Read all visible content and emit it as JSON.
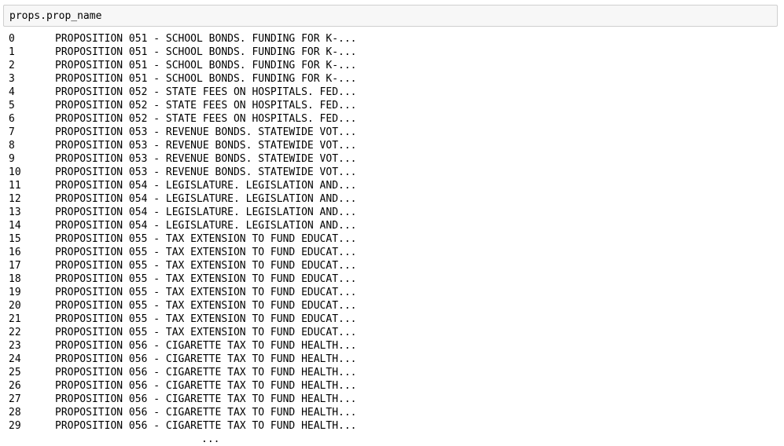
{
  "input": {
    "code": "props.prop_name"
  },
  "output": {
    "rows": [
      {
        "index": "0",
        "value": "PROPOSITION 051 - SCHOOL BONDS. FUNDING FOR K-..."
      },
      {
        "index": "1",
        "value": "PROPOSITION 051 - SCHOOL BONDS. FUNDING FOR K-..."
      },
      {
        "index": "2",
        "value": "PROPOSITION 051 - SCHOOL BONDS. FUNDING FOR K-..."
      },
      {
        "index": "3",
        "value": "PROPOSITION 051 - SCHOOL BONDS. FUNDING FOR K-..."
      },
      {
        "index": "4",
        "value": "PROPOSITION 052 - STATE FEES ON HOSPITALS. FED..."
      },
      {
        "index": "5",
        "value": "PROPOSITION 052 - STATE FEES ON HOSPITALS. FED..."
      },
      {
        "index": "6",
        "value": "PROPOSITION 052 - STATE FEES ON HOSPITALS. FED..."
      },
      {
        "index": "7",
        "value": "PROPOSITION 053 - REVENUE BONDS. STATEWIDE VOT..."
      },
      {
        "index": "8",
        "value": "PROPOSITION 053 - REVENUE BONDS. STATEWIDE VOT..."
      },
      {
        "index": "9",
        "value": "PROPOSITION 053 - REVENUE BONDS. STATEWIDE VOT..."
      },
      {
        "index": "10",
        "value": "PROPOSITION 053 - REVENUE BONDS. STATEWIDE VOT..."
      },
      {
        "index": "11",
        "value": "PROPOSITION 054 - LEGISLATURE. LEGISLATION AND..."
      },
      {
        "index": "12",
        "value": "PROPOSITION 054 - LEGISLATURE. LEGISLATION AND..."
      },
      {
        "index": "13",
        "value": "PROPOSITION 054 - LEGISLATURE. LEGISLATION AND..."
      },
      {
        "index": "14",
        "value": "PROPOSITION 054 - LEGISLATURE. LEGISLATION AND..."
      },
      {
        "index": "15",
        "value": "PROPOSITION 055 - TAX EXTENSION TO FUND EDUCAT..."
      },
      {
        "index": "16",
        "value": "PROPOSITION 055 - TAX EXTENSION TO FUND EDUCAT..."
      },
      {
        "index": "17",
        "value": "PROPOSITION 055 - TAX EXTENSION TO FUND EDUCAT..."
      },
      {
        "index": "18",
        "value": "PROPOSITION 055 - TAX EXTENSION TO FUND EDUCAT..."
      },
      {
        "index": "19",
        "value": "PROPOSITION 055 - TAX EXTENSION TO FUND EDUCAT..."
      },
      {
        "index": "20",
        "value": "PROPOSITION 055 - TAX EXTENSION TO FUND EDUCAT..."
      },
      {
        "index": "21",
        "value": "PROPOSITION 055 - TAX EXTENSION TO FUND EDUCAT..."
      },
      {
        "index": "22",
        "value": "PROPOSITION 055 - TAX EXTENSION TO FUND EDUCAT..."
      },
      {
        "index": "23",
        "value": "PROPOSITION 056 - CIGARETTE TAX TO FUND HEALTH..."
      },
      {
        "index": "24",
        "value": "PROPOSITION 056 - CIGARETTE TAX TO FUND HEALTH..."
      },
      {
        "index": "25",
        "value": "PROPOSITION 056 - CIGARETTE TAX TO FUND HEALTH..."
      },
      {
        "index": "26",
        "value": "PROPOSITION 056 - CIGARETTE TAX TO FUND HEALTH..."
      },
      {
        "index": "27",
        "value": "PROPOSITION 056 - CIGARETTE TAX TO FUND HEALTH..."
      },
      {
        "index": "28",
        "value": "PROPOSITION 056 - CIGARETTE TAX TO FUND HEALTH..."
      },
      {
        "index": "29",
        "value": "PROPOSITION 056 - CIGARETTE TAX TO FUND HEALTH..."
      }
    ],
    "ellipsis": "..."
  }
}
